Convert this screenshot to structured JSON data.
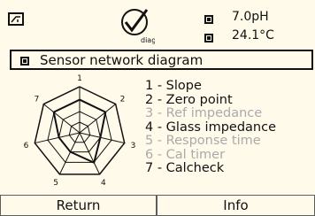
{
  "status": {
    "meter_icon": "meter-icon",
    "diag_icon": "diag-checkmark-icon",
    "diag_label": "diag",
    "ph": "7.0pH",
    "temp": "24.1°C"
  },
  "title": "Sensor network diagram",
  "diagram": {
    "axes": [
      "1",
      "2",
      "3",
      "4",
      "5",
      "6",
      "7"
    ],
    "active_axes": [
      1,
      2,
      4,
      7
    ]
  },
  "legend": [
    {
      "label": "1 - Slope",
      "active": true
    },
    {
      "label": "2 - Zero point",
      "active": true
    },
    {
      "label": "3 - Ref impedance",
      "active": false
    },
    {
      "label": "4 - Glass impedance",
      "active": true
    },
    {
      "label": "5 - Response time",
      "active": false
    },
    {
      "label": "6 - Cal timer",
      "active": false
    },
    {
      "label": "7 - Calcheck",
      "active": true
    }
  ],
  "softkeys": {
    "left": "Return",
    "right": "Info"
  },
  "colors": {
    "background": "#fffaea",
    "foreground": "#111111",
    "inactive": "#aaaaaa",
    "frame": "#5d5d5d"
  }
}
